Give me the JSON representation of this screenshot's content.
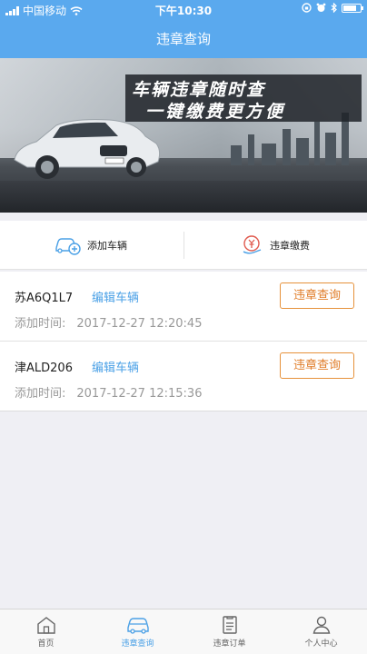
{
  "status_bar": {
    "carrier": "中国移动",
    "time": "下午10:30",
    "battery_level": 0.8
  },
  "nav": {
    "title": "违章查询"
  },
  "banner": {
    "line1": "车辆违章随时查",
    "line2": "一键缴费更方便",
    "car_plate": "DE.AT E60"
  },
  "actions": {
    "add_vehicle": "添加车辆",
    "pay_violation": "违章缴费"
  },
  "vehicles": [
    {
      "plate": "苏A6Q1L7",
      "edit_label": "编辑车辆",
      "added_label": "添加时间:",
      "added_time": "2017-12-27 12:20:45",
      "query_label": "违章查询"
    },
    {
      "plate": "津ALD206",
      "edit_label": "编辑车辆",
      "added_label": "添加时间:",
      "added_time": "2017-12-27 12:15:36",
      "query_label": "违章查询"
    }
  ],
  "tabs": [
    {
      "label": "首页",
      "icon": "home-icon",
      "active": false
    },
    {
      "label": "违章查询",
      "icon": "car-icon",
      "active": true
    },
    {
      "label": "违章订单",
      "icon": "order-icon",
      "active": false
    },
    {
      "label": "个人中心",
      "icon": "user-icon",
      "active": false
    }
  ],
  "colors": {
    "primary": "#5aa9ee",
    "accent_orange": "#e6913a",
    "link_blue": "#4aa0e6"
  }
}
